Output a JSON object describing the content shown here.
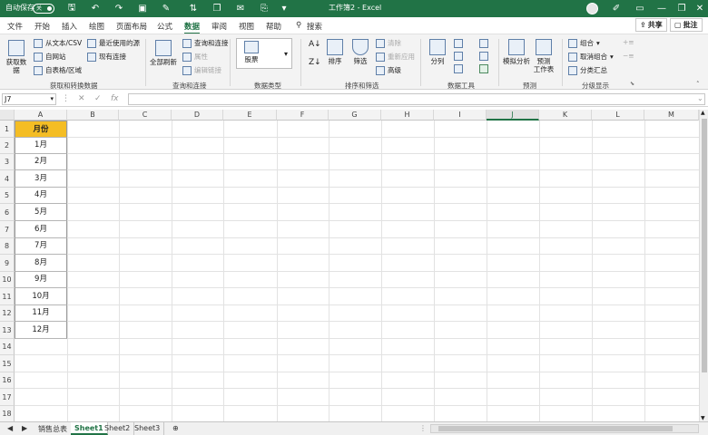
{
  "titlebar": {
    "autosave_label": "自动保存",
    "autosave_state": "关",
    "doc_title": "工作簿2 - Excel",
    "icons": [
      "save-icon",
      "undo-icon",
      "redo-icon",
      "print-preview-icon",
      "format-painter-icon",
      "sort-icon",
      "copy-icon",
      "email-icon",
      "paste-icon",
      "more-icon"
    ]
  },
  "tabs": [
    "文件",
    "开始",
    "插入",
    "绘图",
    "页面布局",
    "公式",
    "数据",
    "审阅",
    "视图",
    "帮助"
  ],
  "active_tab": "数据",
  "search_label": "搜索",
  "share_label": "共享",
  "comment_label": "批注",
  "ribbon": {
    "get_data": {
      "label": "获取和转换数据",
      "big_button": "获取数\n据",
      "items": [
        "从文本/CSV",
        "自网站",
        "自表格/区域",
        "最近使用的源",
        "现有连接"
      ]
    },
    "queries": {
      "label": "查询和连接",
      "big_button": "全部刷新",
      "items": [
        "查询和连接",
        "属性",
        "编辑链接"
      ]
    },
    "data_types": {
      "label": "数据类型",
      "stock": "股票"
    },
    "sort_filter": {
      "label": "排序和筛选",
      "sort": "排序",
      "filter": "筛选",
      "clear": "清除",
      "reapply": "重新应用",
      "advanced": "高级"
    },
    "data_tools": {
      "label": "数据工具",
      "split": "分列"
    },
    "forecast": {
      "label": "预测",
      "whatif": "模拟分析",
      "sheet": "预测\n工作表"
    },
    "outline": {
      "label": "分级显示",
      "group": "组合",
      "ungroup": "取消组合",
      "subtotal": "分类汇总"
    }
  },
  "formula_bar": {
    "name_box": "J7",
    "formula": ""
  },
  "columns": [
    "A",
    "B",
    "C",
    "D",
    "E",
    "F",
    "G",
    "H",
    "I",
    "J",
    "K",
    "L",
    "M"
  ],
  "rows": [
    "1",
    "2",
    "3",
    "4",
    "5",
    "6",
    "7",
    "8",
    "9",
    "10",
    "11",
    "12",
    "13",
    "14",
    "15",
    "16",
    "17",
    "18"
  ],
  "column_a": {
    "header": "月份",
    "values": [
      "1月",
      "2月",
      "3月",
      "4月",
      "5月",
      "6月",
      "7月",
      "8月",
      "9月",
      "10月",
      "11月",
      "12月"
    ]
  },
  "sheets": [
    "销售总表",
    "Sheet1",
    "Sheet2",
    "Sheet3"
  ],
  "active_sheet": "Sheet1",
  "colors": {
    "brand": "#217346",
    "header_fill": "#f4bd24"
  }
}
